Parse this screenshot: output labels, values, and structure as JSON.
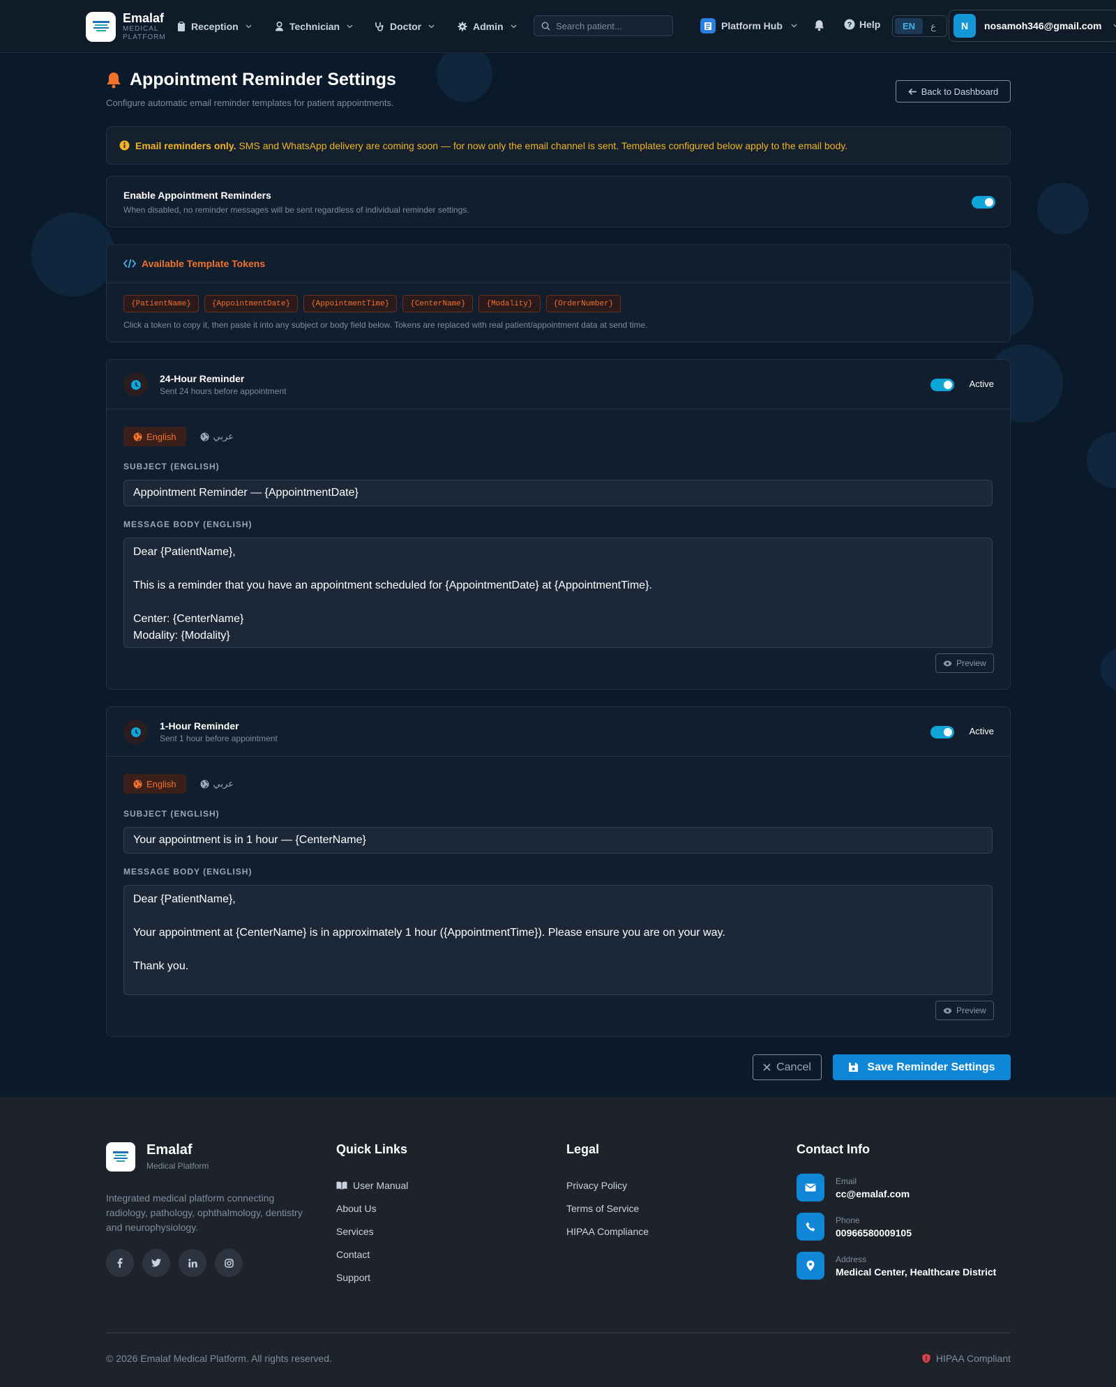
{
  "navbar": {
    "brand_name": "Emalaf",
    "brand_sub": "MEDICAL",
    "brand_sub2": "PLATFORM",
    "menu": [
      {
        "label": "Reception"
      },
      {
        "label": "Technician"
      },
      {
        "label": "Doctor"
      },
      {
        "label": "Admin"
      }
    ],
    "search_placeholder": "Search patient...",
    "hub_label": "Platform Hub",
    "help_label": "Help",
    "lang_en": "EN",
    "lang_ar": "ع",
    "avatar_letter": "N",
    "user_email": "nosamoh346@gmail.com"
  },
  "header": {
    "title": "Appointment Reminder Settings",
    "subtitle": "Configure automatic email reminder templates for patient appointments.",
    "back_label": "Back to Dashboard"
  },
  "notice": {
    "bold": "Email reminders only.",
    "text": "SMS and WhatsApp delivery are coming soon — for now only the email channel is sent. Templates configured below apply to the email body."
  },
  "enable": {
    "title": "Enable Appointment Reminders",
    "subtitle": "When disabled, no reminder messages will be sent regardless of individual reminder settings.",
    "enabled": true
  },
  "tokens": {
    "title": "Available Template Tokens",
    "items": [
      "{PatientName}",
      "{AppointmentDate}",
      "{AppointmentTime}",
      "{CenterName}",
      "{Modality}",
      "{OrderNumber}"
    ],
    "hint": "Click a token to copy it, then paste it into any subject or body field below. Tokens are replaced with real patient/appointment data at send time."
  },
  "reminders": [
    {
      "title": "24-Hour Reminder",
      "subtitle": "Sent 24 hours before appointment",
      "status": "Active",
      "tab_en": "English",
      "tab_ar": "عربي",
      "subject_label": "SUBJECT (ENGLISH)",
      "subject": "Appointment Reminder — {AppointmentDate}",
      "body_label": "MESSAGE BODY (ENGLISH)",
      "body": "Dear {PatientName},\n\nThis is a reminder that you have an appointment scheduled for {AppointmentDate} at {AppointmentTime}.\n\nCenter: {CenterName}\nModality: {Modality}",
      "preview_label": "Preview"
    },
    {
      "title": "1-Hour Reminder",
      "subtitle": "Sent 1 hour before appointment",
      "status": "Active",
      "tab_en": "English",
      "tab_ar": "عربي",
      "subject_label": "SUBJECT (ENGLISH)",
      "subject": "Your appointment is in 1 hour — {CenterName}",
      "body_label": "MESSAGE BODY (ENGLISH)",
      "body": "Dear {PatientName},\n\nYour appointment at {CenterName} is in approximately 1 hour ({AppointmentTime}). Please ensure you are on your way.\n\nThank you.",
      "preview_label": "Preview"
    }
  ],
  "actions": {
    "cancel": "Cancel",
    "save": "Save Reminder Settings"
  },
  "footer": {
    "brand_name": "Emalaf",
    "brand_sub": "Medical Platform",
    "description": "Integrated medical platform connecting radiology, pathology, ophthalmology, dentistry and neurophysiology.",
    "socials": [
      "facebook-icon",
      "twitter-icon",
      "linkedin-icon",
      "instagram-icon"
    ],
    "quick_links_title": "Quick Links",
    "quick_links": [
      "User Manual",
      "About Us",
      "Services",
      "Contact",
      "Support"
    ],
    "legal_title": "Legal",
    "legal_links": [
      "Privacy Policy",
      "Terms of Service",
      "HIPAA Compliance"
    ],
    "contact_title": "Contact Info",
    "contact": [
      {
        "label": "Email",
        "value": "cc@emalaf.com"
      },
      {
        "label": "Phone",
        "value": "00966580009105"
      },
      {
        "label": "Address",
        "value": "Medical Center, Healthcare District"
      }
    ],
    "copyright": "© 2026 Emalaf Medical Platform. All rights reserved.",
    "hipaa": "HIPAA Compliant"
  },
  "colors": {
    "background": "#0b1a2b",
    "accent_blue": "#0f86d6",
    "accent_orange": "#f0722b",
    "warning": "#f0b323",
    "toggle_on": "#0ea5d8"
  }
}
